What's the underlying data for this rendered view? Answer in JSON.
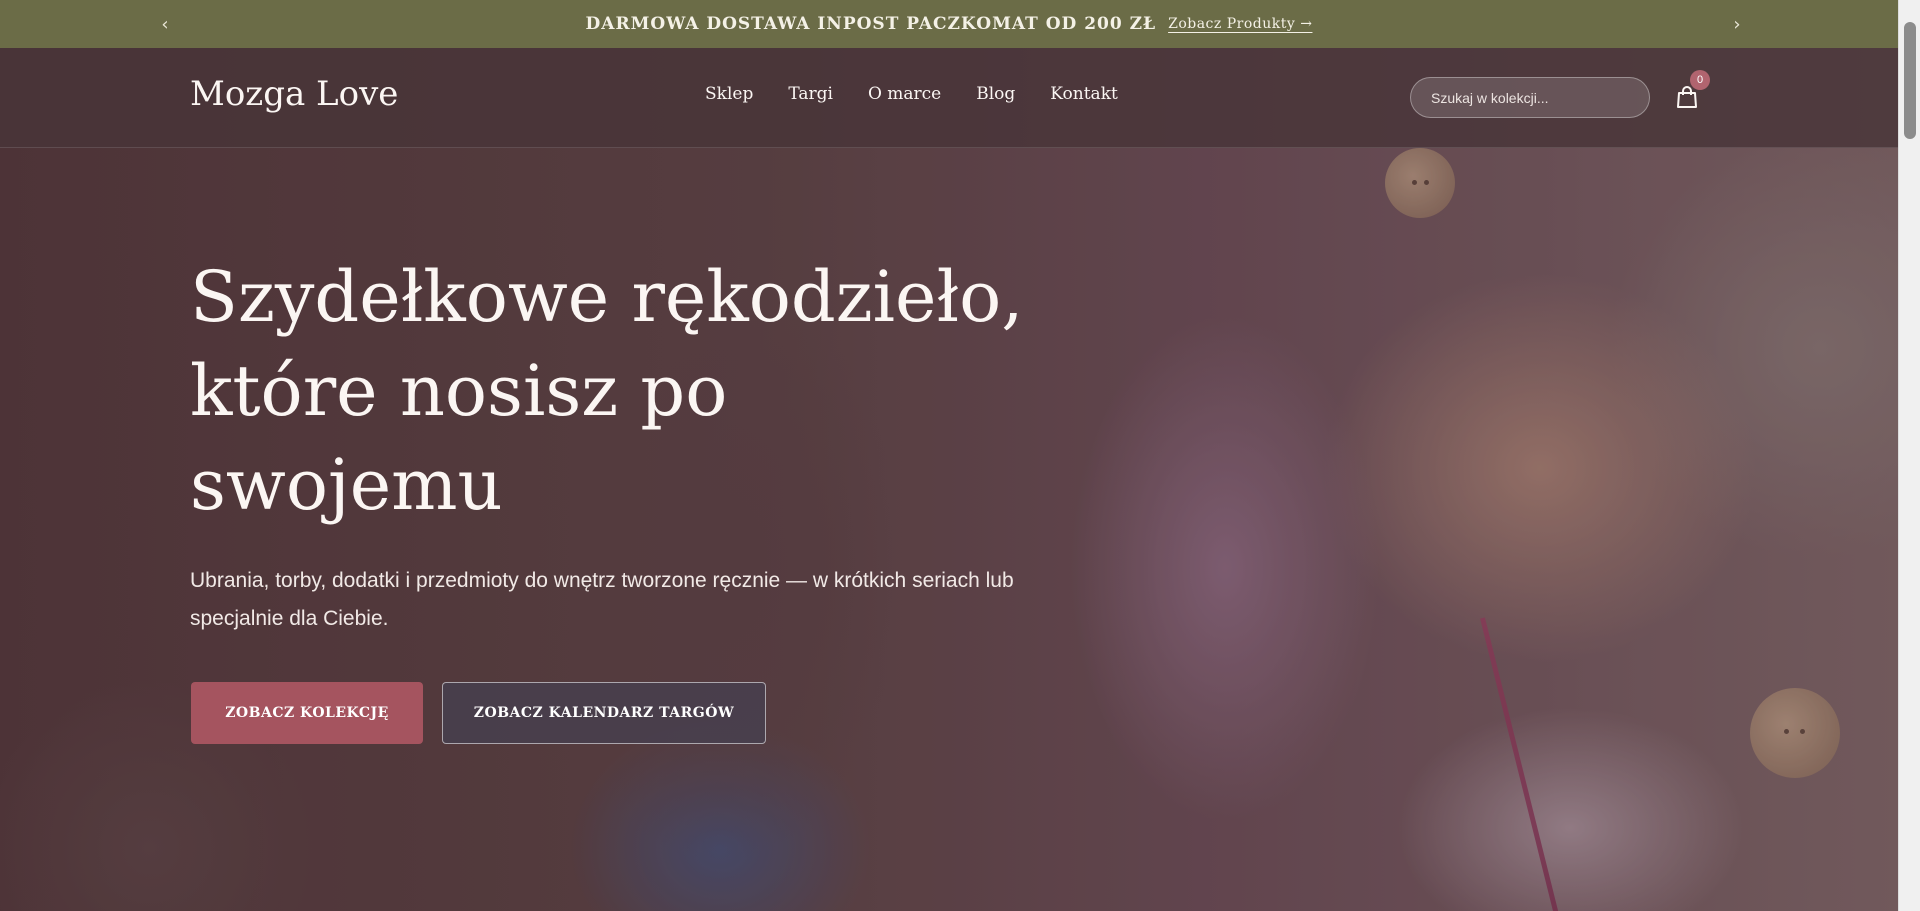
{
  "announcement": {
    "message": "DARMOWA DOSTAWA INPOST PACZKOMAT OD 200 ZŁ",
    "link_label": "Zobacz Produkty →",
    "prev_arrow": "‹",
    "next_arrow": "›"
  },
  "header": {
    "logo": "Mozga Love",
    "nav": [
      "Sklep",
      "Targi",
      "O marce",
      "Blog",
      "Kontakt"
    ],
    "search_placeholder": "Szukaj w kolekcji...",
    "cart_count": "0",
    "cart_icon": "shopping-bag-icon"
  },
  "hero": {
    "title": "Szydełkowe rękodzieło, które nosisz po swojemu",
    "subtitle": "Ubrania, torby, dodatki i przedmioty do wnętrz tworzone ręcznie — w krótkich seriach lub specjalnie dla Ciebie.",
    "primary_button": "ZOBACZ KOLEKCJĘ",
    "secondary_button": "ZOBACZ KALENDARZ TARGÓW"
  },
  "colors": {
    "announcement_bg": "#6b6c47",
    "primary_button": "#a5545f",
    "cart_badge": "#b1646f"
  }
}
